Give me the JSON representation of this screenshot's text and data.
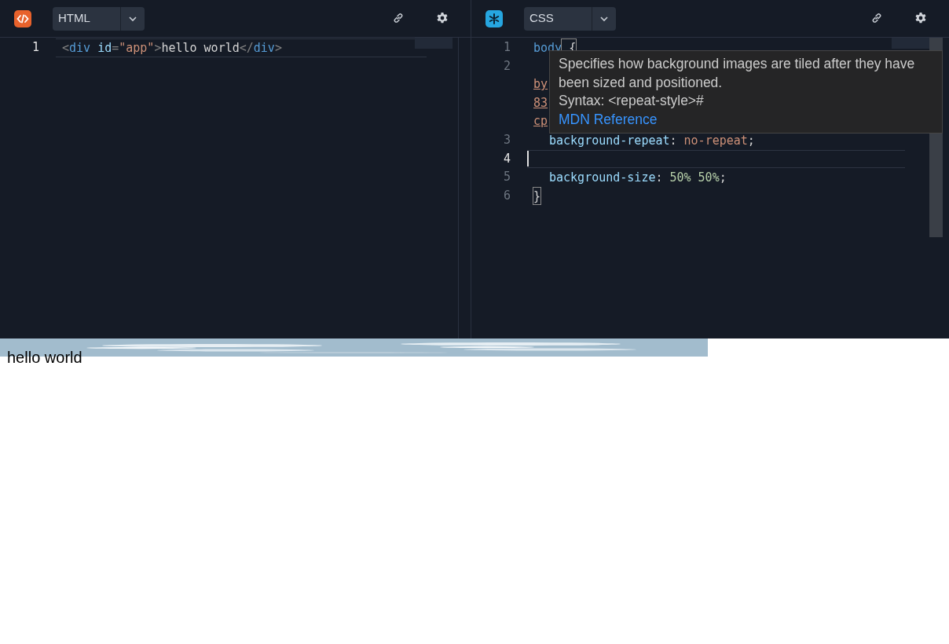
{
  "panes": [
    {
      "kind": "html",
      "language": "HTML",
      "lines": [
        {
          "number": "1",
          "current": true,
          "kind": "code",
          "tokens": [
            {
              "text": "<",
              "kind": "punct"
            },
            {
              "text": "div",
              "kind": "tag"
            },
            {
              "text": "id",
              "kind": "attr",
              "gap": true
            },
            {
              "text": "=",
              "kind": "punct"
            },
            {
              "text": "\"app\"",
              "kind": "string"
            },
            {
              "text": ">",
              "kind": "punct"
            },
            {
              "text": "hello world",
              "kind": "text"
            },
            {
              "text": "</",
              "kind": "punct"
            },
            {
              "text": "div",
              "kind": "tag"
            },
            {
              "text": ">",
              "kind": "punct"
            }
          ]
        }
      ]
    },
    {
      "kind": "css",
      "language": "CSS",
      "lines": [
        {
          "number": "1",
          "current": false,
          "kind": "code",
          "tokens": [
            {
              "text": "body",
              "kind": "tag"
            },
            {
              "text": "{",
              "kind": "bracket",
              "gap": true
            }
          ]
        },
        {
          "number": "2",
          "current": false,
          "kind": "wrapped",
          "fragments": [
            "by",
            "83",
            "cp"
          ]
        },
        {
          "number": "3",
          "current": false,
          "kind": "code",
          "indent": true,
          "tokens": [
            {
              "text": "background-repeat",
              "kind": "attr"
            },
            {
              "text": ":",
              "kind": "text"
            },
            {
              "text": "no-repeat",
              "kind": "string",
              "gap": true
            },
            {
              "text": ";",
              "kind": "text"
            }
          ]
        },
        {
          "number": "4",
          "current": true,
          "kind": "cursor"
        },
        {
          "number": "5",
          "current": false,
          "kind": "code",
          "indent": true,
          "tokens": [
            {
              "text": "background-size",
              "kind": "attr"
            },
            {
              "text": ":",
              "kind": "text"
            },
            {
              "text": "50%",
              "kind": "number",
              "gap": true
            },
            {
              "text": "50%",
              "kind": "number",
              "gap": true
            },
            {
              "text": ";",
              "kind": "text"
            }
          ]
        },
        {
          "number": "6",
          "current": false,
          "kind": "code",
          "tokens": [
            {
              "text": "}",
              "kind": "bracket"
            }
          ]
        }
      ],
      "tooltip": {
        "description": "Specifies how background images are tiled after they have been sized and positioned.",
        "syntax": "Syntax: <repeat-style>#",
        "link": "MDN Reference"
      }
    }
  ],
  "preview": {
    "text": "hello world"
  }
}
